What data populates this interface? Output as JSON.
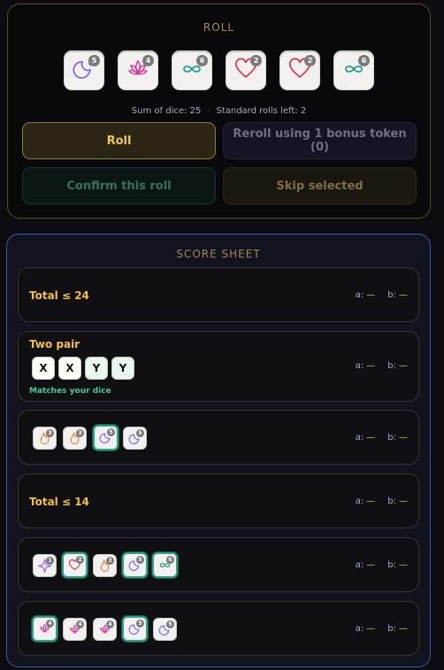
{
  "roll": {
    "title": "ROLL",
    "dice": [
      {
        "icon": "moon-star-icon",
        "count": "5",
        "color": "#7b5cf0"
      },
      {
        "icon": "lotus-icon",
        "count": "4",
        "color": "#d8389a"
      },
      {
        "icon": "infinity-icon",
        "count": "6",
        "color": "#1f9a88"
      },
      {
        "icon": "heart-icon",
        "count": "2",
        "color": "#e0304a"
      },
      {
        "icon": "heart-icon",
        "count": "2",
        "color": "#e0304a"
      },
      {
        "icon": "infinity-icon",
        "count": "6",
        "color": "#1f9a88"
      }
    ],
    "sum_label": "Sum of dice: 25",
    "rolls_left_label": "Standard rolls left: 2",
    "buttons": {
      "roll": "Roll",
      "reroll": "Reroll using 1 bonus token (0)",
      "confirm": "Confirm this roll",
      "skip": "Skip selected"
    }
  },
  "score_sheet": {
    "title": "SCORE SHEET",
    "score_a_label": "a:",
    "score_b_label": "b:",
    "score_a_value": "—",
    "score_b_value": "—",
    "rows": [
      {
        "label": "Total ≤ 24"
      },
      {
        "label": "Two pair",
        "pattern": [
          "X",
          "X",
          "Y",
          "Y"
        ],
        "match_text": "Matches your dice"
      },
      {
        "dice": [
          {
            "icon": "flame-icon",
            "count": "3"
          },
          {
            "icon": "flame-icon",
            "count": "3"
          },
          {
            "icon": "moon-star-icon",
            "count": "5",
            "highlight": true
          },
          {
            "icon": "moon-star-icon",
            "count": "5"
          }
        ]
      },
      {
        "label": "Total ≤ 14"
      },
      {
        "dice": [
          {
            "icon": "sparkle-icon",
            "count": "1"
          },
          {
            "icon": "heart-icon",
            "count": "2",
            "highlight": true
          },
          {
            "icon": "flame-icon",
            "count": "3"
          },
          {
            "icon": "moon-star-icon",
            "count": "5",
            "highlight": true
          },
          {
            "icon": "infinity-icon",
            "count": "6",
            "highlight": true
          }
        ]
      },
      {
        "dice": [
          {
            "icon": "lotus-icon",
            "count": "4",
            "highlight": true
          },
          {
            "icon": "lotus-icon",
            "count": "4"
          },
          {
            "icon": "lotus-icon",
            "count": "4"
          },
          {
            "icon": "moon-star-icon",
            "count": "5",
            "highlight": true
          },
          {
            "icon": "moon-star-icon",
            "count": "5"
          }
        ]
      }
    ]
  }
}
